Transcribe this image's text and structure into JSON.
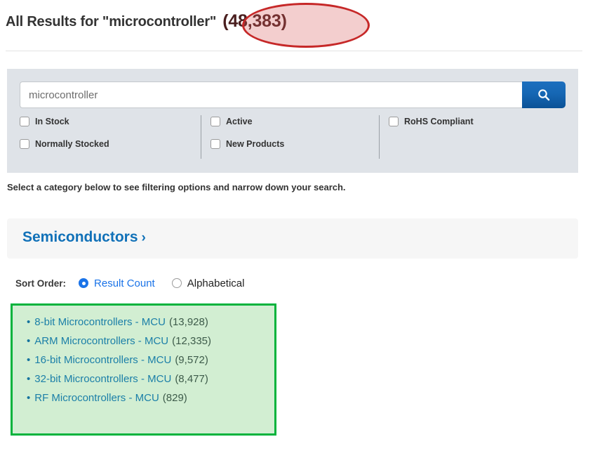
{
  "header": {
    "title_prefix": "All Results for \"microcontroller\"",
    "result_count": "(48,383)",
    "annotation_shape": "red-ellipse-highlight"
  },
  "search": {
    "value": "microcontroller",
    "placeholder": "microcontroller",
    "button_icon": "search-icon"
  },
  "filters": {
    "columns": [
      {
        "items": [
          {
            "label": "In Stock",
            "checked": false
          },
          {
            "label": "Normally Stocked",
            "checked": false
          }
        ]
      },
      {
        "items": [
          {
            "label": "Active",
            "checked": false
          },
          {
            "label": "New Products",
            "checked": false
          }
        ]
      },
      {
        "items": [
          {
            "label": "RoHS Compliant",
            "checked": false
          }
        ]
      }
    ]
  },
  "instruction": "Select a category below to see filtering options and narrow down your search.",
  "category": {
    "label": "Semiconductors",
    "chevron": "›"
  },
  "sort": {
    "label": "Sort Order:",
    "options": [
      {
        "label": "Result Count",
        "selected": true
      },
      {
        "label": "Alphabetical",
        "selected": false
      }
    ]
  },
  "results": {
    "annotation_shape": "green-rectangle-highlight",
    "items": [
      {
        "name": "8-bit Microcontrollers - MCU",
        "count": "(13,928)"
      },
      {
        "name": "ARM Microcontrollers - MCU",
        "count": "(12,335)"
      },
      {
        "name": "16-bit Microcontrollers - MCU",
        "count": "(9,572)"
      },
      {
        "name": "32-bit Microcontrollers - MCU",
        "count": "(8,477)"
      },
      {
        "name": "RF Microcontrollers - MCU",
        "count": "(829)"
      }
    ]
  },
  "colors": {
    "link_blue": "#1171b8",
    "accent_blue": "#1a73e8",
    "panel_grey": "#dfe3e8",
    "annotation_red": "#c62828",
    "annotation_green": "#00b33c"
  }
}
